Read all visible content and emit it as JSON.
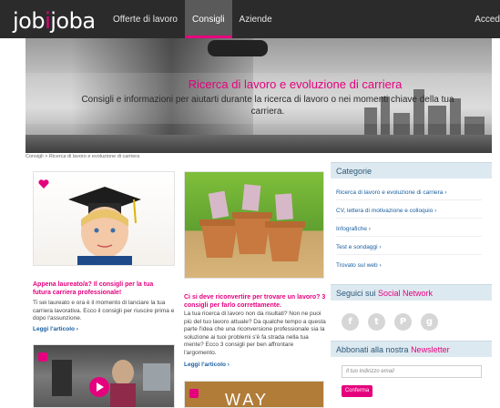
{
  "logo": {
    "part1": "job",
    "part2": "i",
    "part3": "joba"
  },
  "nav": {
    "items": [
      {
        "label": "Offerte di lavoro"
      },
      {
        "label": "Consigli"
      },
      {
        "label": "Aziende"
      }
    ],
    "login_label": "Acced"
  },
  "hero": {
    "title": "Ricerca di lavoro e evoluzione di carriera",
    "subtitle": "Consigli e informazioni per aiutarti durante la ricerca di lavoro o nei momenti chiave della tua carriera."
  },
  "breadcrumb": "Consigli > Ricerca di lavoro e evoluzione di carriera",
  "articles": [
    {
      "title": "Appena laureato/a? Il consigli per la tua futura carriera professionale!",
      "text": "Ti sei laureato e ora è il momento di lanciare la tua carriera lavorativa. Ecco il consigli per riuscire prima e dopo l'assunzione.",
      "link": "Leggi l'articolo"
    },
    {
      "title": "Ci si deve riconvertire per trovare un lavoro? 3 consigli per farlo correttamente.",
      "text": "La tua ricerca di lavoro non da risultati? Non ne puoi più del tuo lavoro attuale? Da qualche tempo a questa parte l'idea che una riconversione professionale sia la soluzione ai tuoi problemi s'è fa strada nella tua mente? Ecco 3 consigli per ben affrontare l'argomento.",
      "link": "Leggi l'articolo"
    }
  ],
  "bottom_card_text": "WAY",
  "sidebar": {
    "categories_title": "Categorie",
    "categories": [
      "Ricerca di lavoro e evoluzione di carriera",
      "CV, lettera di motivazione e colloquio",
      "Infografiche",
      "Test e sondaggi",
      "Trovato sul web"
    ],
    "social_title_plain": "Seguici sui ",
    "social_title_pink": "Social Network",
    "social_icons": [
      "facebook-icon",
      "twitter-icon",
      "pinterest-icon",
      "google-plus-icon"
    ],
    "newsletter_title_plain": "Abbonati alla nostra ",
    "newsletter_title_pink": "Newsletter",
    "email_placeholder": "Il tuo indirizzo email",
    "confirm_label": "Conferma"
  },
  "colors": {
    "accent": "#e5007e",
    "topbar": "#2b2b2b",
    "sidebar_head": "#dde9f0",
    "link": "#1a5fa0"
  }
}
